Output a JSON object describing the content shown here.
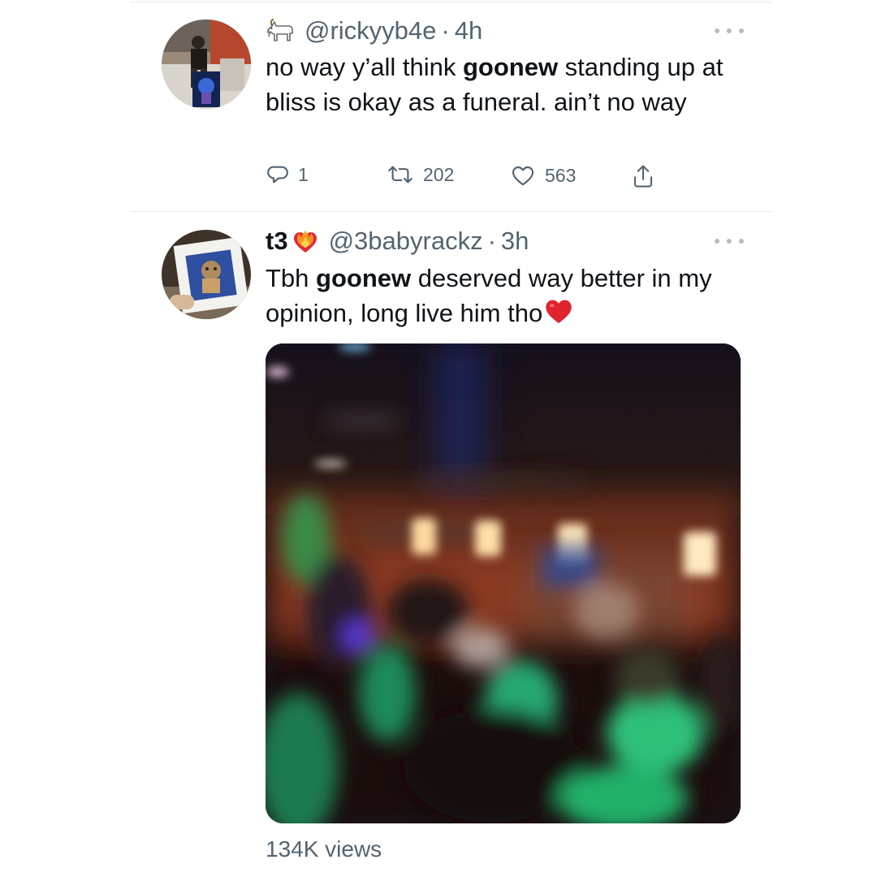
{
  "tweet1": {
    "handle": "@rickyyb4e",
    "separator": "·",
    "time": "4h",
    "badge_icon": "goat-emoji",
    "text_before": "no way y’all think ",
    "text_bold": "goonew",
    "text_after": " standing up at bliss is okay as a funeral. ain’t no way",
    "replies": "1",
    "retweets": "202",
    "likes": "563"
  },
  "tweet2": {
    "display_name": "t3",
    "name_emoji": "heart-on-fire-emoji",
    "handle": "@3babyrackz",
    "separator": "·",
    "time": "3h",
    "text_before": "Tbh ",
    "text_bold": "goonew",
    "text_after": " deserved way better in my opinion, long live him tho",
    "text_emoji": "red-heart-emoji",
    "views": "134K views"
  },
  "colors": {
    "text_primary": "#0f1419",
    "text_secondary": "#536471",
    "divider": "#e6e9ec"
  }
}
